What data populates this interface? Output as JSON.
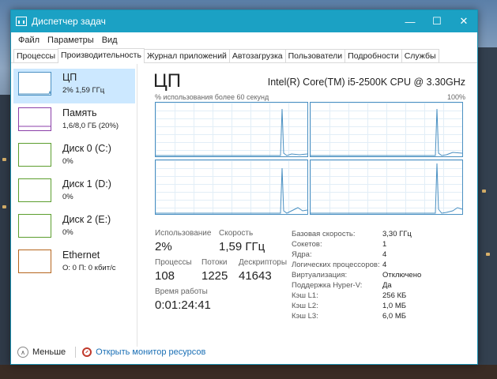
{
  "window": {
    "title": "Диспетчер задач",
    "controls": [
      "—",
      "☐",
      "✕"
    ]
  },
  "menu": [
    "Файл",
    "Параметры",
    "Вид"
  ],
  "tabs": [
    "Процессы",
    "Производительность",
    "Журнал приложений",
    "Автозагрузка",
    "Пользователи",
    "Подробности",
    "Службы"
  ],
  "active_tab": "Производительность",
  "sidebar": [
    {
      "name": "ЦП",
      "value": "2% 1,59 ГГц",
      "color": "#4a90c2",
      "selected": true
    },
    {
      "name": "Память",
      "value": "1,6/8,0 ГБ (20%)",
      "color": "#8b3fa8",
      "selected": false
    },
    {
      "name": "Диск 0 (C:)",
      "value": "0%",
      "color": "#5c9e2e",
      "selected": false
    },
    {
      "name": "Диск 1 (D:)",
      "value": "0%",
      "color": "#5c9e2e",
      "selected": false
    },
    {
      "name": "Диск 2 (E:)",
      "value": "0%",
      "color": "#5c9e2e",
      "selected": false
    },
    {
      "name": "Ethernet",
      "value": "О: 0 П: 0 кбит/с",
      "color": "#b5651d",
      "selected": false
    }
  ],
  "detail": {
    "title": "ЦП",
    "model": "Intel(R) Core(TM) i5-2500K CPU @ 3.30GHz",
    "graph_label": "% использования более 60 секунд",
    "graph_max": "100%",
    "stats": {
      "usage_label": "Использование",
      "usage_value": "2%",
      "speed_label": "Скорость",
      "speed_value": "1,59 ГГц",
      "processes_label": "Процессы",
      "processes_value": "108",
      "threads_label": "Потоки",
      "threads_value": "1225",
      "handles_label": "Дескрипторы",
      "handles_value": "41643",
      "uptime_label": "Время работы",
      "uptime_value": "0:01:24:41"
    },
    "specs": [
      {
        "label": "Базовая скорость:",
        "value": "3,30 ГГц"
      },
      {
        "label": "Сокетов:",
        "value": "1"
      },
      {
        "label": "Ядра:",
        "value": "4"
      },
      {
        "label": "Логических процессоров:",
        "value": "4"
      },
      {
        "label": "Виртуализация:",
        "value": "Отключено"
      },
      {
        "label": "Поддержка Hyper-V:",
        "value": "Да"
      },
      {
        "label": "Кэш L1:",
        "value": "256 КБ"
      },
      {
        "label": "Кэш L2:",
        "value": "1,0 МБ"
      },
      {
        "label": "Кэш L3:",
        "value": "6,0 МБ"
      }
    ]
  },
  "footer": {
    "fewer_label": "Меньше",
    "monitor_label": "Открыть монитор ресурсов"
  }
}
